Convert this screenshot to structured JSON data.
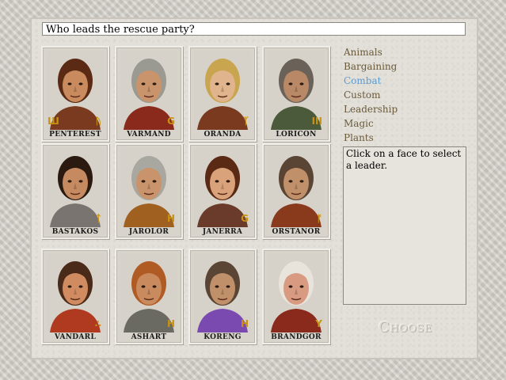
{
  "question": "Who leads the rescue party?",
  "skills": [
    {
      "label": "Animals",
      "selected": false
    },
    {
      "label": "Bargaining",
      "selected": false
    },
    {
      "label": "Combat",
      "selected": true
    },
    {
      "label": "Custom",
      "selected": false
    },
    {
      "label": "Leadership",
      "selected": false
    },
    {
      "label": "Magic",
      "selected": false
    },
    {
      "label": "Plants",
      "selected": false
    }
  ],
  "info_text": "Click on a face to select a leader.",
  "choose_label": "Choose",
  "characters": [
    {
      "name": "PENTEREST",
      "rune_left": "Ш",
      "rune_right": "ᚢ",
      "hair": "#5a2a14",
      "skin": "#c98a5e",
      "cloth": "#7a3a20"
    },
    {
      "name": "VARMAND",
      "rune_left": "",
      "rune_right": "G",
      "hair": "#9a9a92",
      "skin": "#c9936b",
      "cloth": "#8a2a1c"
    },
    {
      "name": "ORANDA",
      "rune_left": "",
      "rune_right": "ᛉ",
      "hair": "#c9a550",
      "skin": "#e0b48c",
      "cloth": "#7a3a20"
    },
    {
      "name": "LORICON",
      "rune_left": "",
      "rune_right": "III",
      "hair": "#6a6258",
      "skin": "#b98866",
      "cloth": "#4a5a3a"
    },
    {
      "name": "BASTAKOS",
      "rune_left": "",
      "rune_right": "ᛏ",
      "hair": "#2a1a10",
      "skin": "#c58a60",
      "cloth": "#7a7470"
    },
    {
      "name": "JAROLOR",
      "rune_left": "",
      "rune_right": "H",
      "hair": "#a8a8a0",
      "skin": "#c9936b",
      "cloth": "#a06020"
    },
    {
      "name": "JANERRA",
      "rune_left": "",
      "rune_right": "G",
      "hair": "#5a2a14",
      "skin": "#d9a27a",
      "cloth": "#6a3a2a"
    },
    {
      "name": "ORSTANOR",
      "rune_left": "",
      "rune_right": "ᚠ",
      "hair": "#5a4434",
      "skin": "#c0906a",
      "cloth": "#8a3a1c"
    },
    {
      "name": "VANDARL",
      "rune_left": "",
      "rune_right": "∴",
      "hair": "#4a2a18",
      "skin": "#d08c60",
      "cloth": "#b03a20"
    },
    {
      "name": "ASHART",
      "rune_left": "",
      "rune_right": "H",
      "hair": "#b05a24",
      "skin": "#c98a5e",
      "cloth": "#6a6a62"
    },
    {
      "name": "KORENG",
      "rune_left": "",
      "rune_right": "H",
      "hair": "#5a4434",
      "skin": "#c0906a",
      "cloth": "#7a4ab0"
    },
    {
      "name": "BRANDGOR",
      "rune_left": "",
      "rune_right": "Y",
      "hair": "#e8e4dc",
      "skin": "#d89a80",
      "cloth": "#8a2a1c"
    }
  ]
}
